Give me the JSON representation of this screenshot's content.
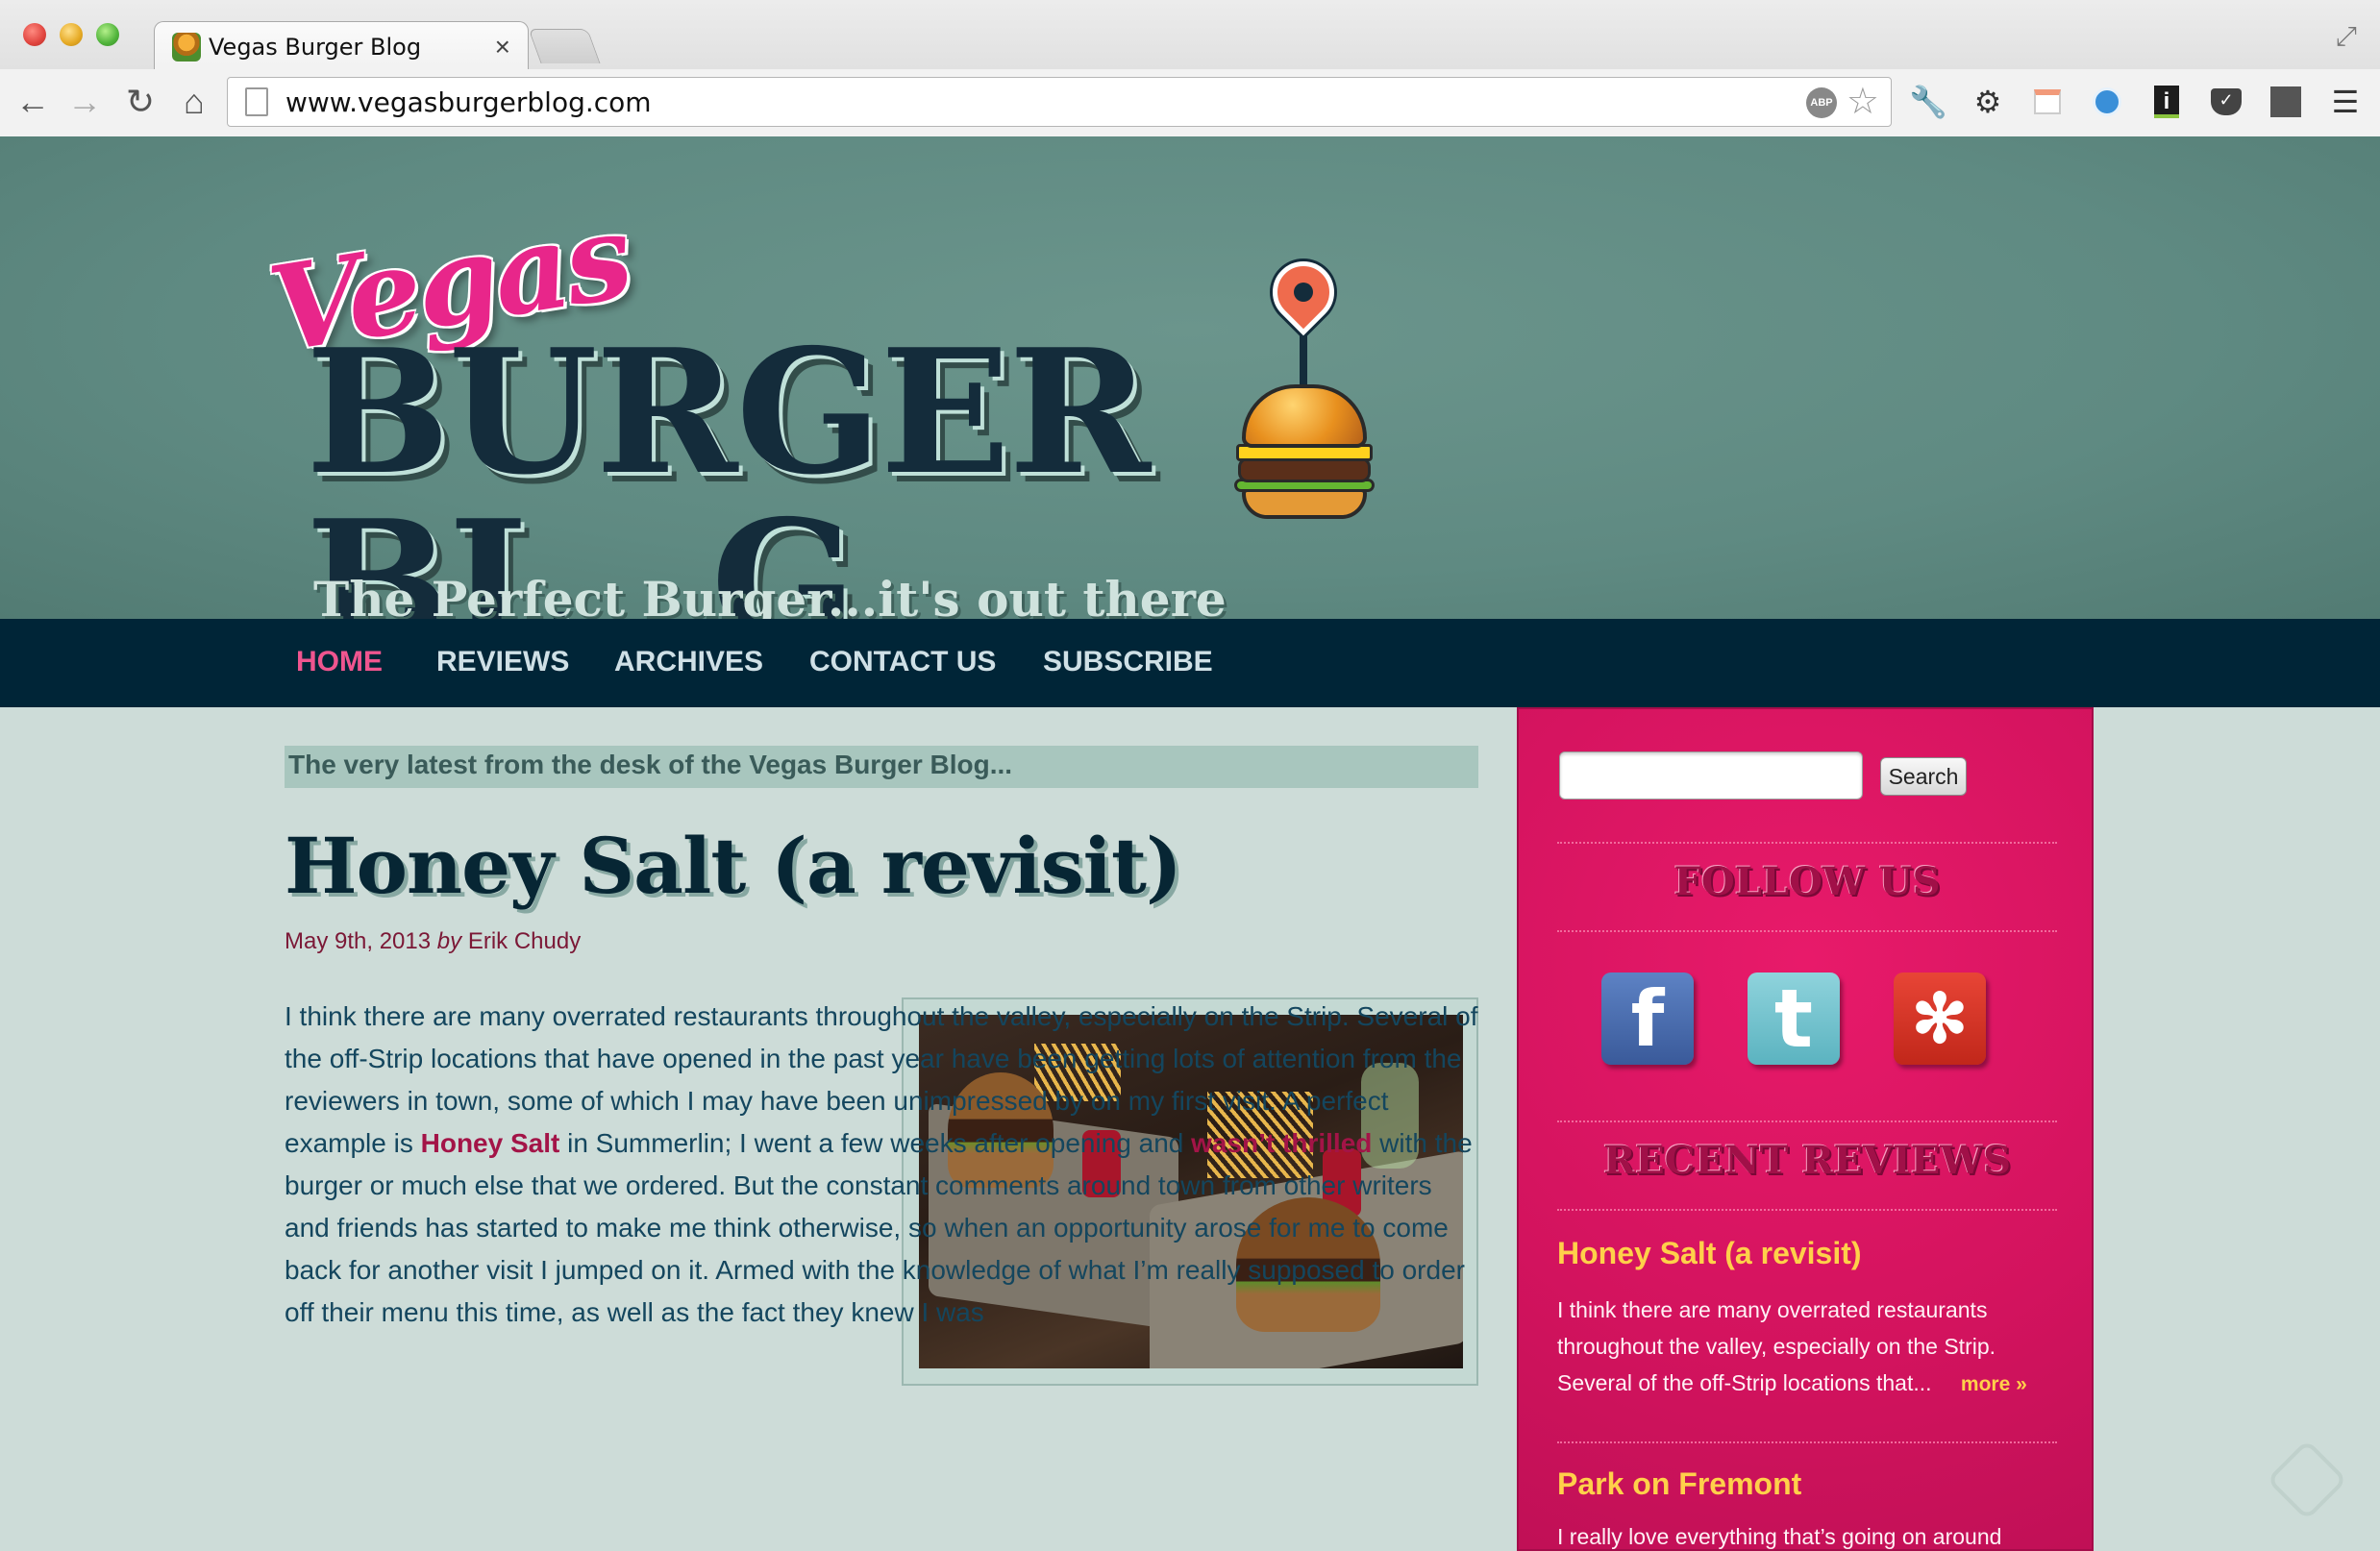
{
  "browser": {
    "tab_title": "Vegas Burger Blog",
    "tab_close": "×",
    "url": "www.vegasburgerblog.com",
    "back": "←",
    "forward": "→",
    "reload": "↻",
    "home": "⌂",
    "abp_label": "ABP",
    "star": "☆",
    "extensions": [
      "wrench-icon",
      "gear-icon",
      "calendar-icon",
      "phone-icon",
      "info-icon",
      "pocket-icon",
      "evernote-icon",
      "menu-icon"
    ]
  },
  "header": {
    "logo_vegas": "Vegas",
    "logo_main": "BURGER BL",
    "logo_g": "G",
    "tagline": "The Perfect Burger...it's out there"
  },
  "nav": {
    "items": [
      {
        "label": "HOME",
        "active": true
      },
      {
        "label": "REVIEWS",
        "active": false
      },
      {
        "label": "ARCHIVES",
        "active": false
      },
      {
        "label": "CONTACT US",
        "active": false
      },
      {
        "label": "SUBSCRIBE",
        "active": false
      }
    ]
  },
  "main": {
    "latest_text": "The very latest from the desk of the Vegas Burger Blog...",
    "post": {
      "title": "Honey Salt (a revisit)",
      "date": "May 9th, 2013",
      "by": "by",
      "author": "Erik Chudy",
      "body_intro": "I think there are many overrated restaurants throughout the valley, especially on the Strip. Several of the off-Strip locations that have opened in the past year have been getting lots of attention from the reviewers in town, some of which I may have been unimpressed by on my first visit. A perfect example is",
      "link1": "Honey Salt",
      "body_mid1": "in Summerlin; I went a few weeks after opening and",
      "link2": "wasn’t thrilled",
      "body_mid2": "with the burger or much else that we ordered. But the constant comments around town from other writers and friends has started to make me think otherwise, so when an opportunity arose for me to come back for another visit I jumped on it. Armed with the knowledge of what I’m really supposed to order off their menu this time, as well as the fact they knew I was"
    }
  },
  "sidebar": {
    "search_placeholder": "",
    "search_button": "Search",
    "follow_title": "FOLLOW US",
    "social": [
      {
        "name": "facebook-icon",
        "glyph": "f"
      },
      {
        "name": "twitter-icon",
        "glyph": "t"
      },
      {
        "name": "yelp-icon",
        "glyph": "✻"
      }
    ],
    "recent_title": "RECENT REVIEWS",
    "reviews": [
      {
        "title": "Honey Salt (a revisit)",
        "excerpt": "I think there are many overrated restaurants throughout the valley, especially on the Strip. Several of the off-Strip locations that...",
        "more": "more »"
      },
      {
        "title": "Park on Fremont",
        "excerpt": "I really love everything that’s going on around",
        "more": ""
      }
    ]
  },
  "colors": {
    "header_bg": "#5f8a82",
    "nav_bg": "#002537",
    "nav_active": "#f0558f",
    "sidebar_bg": "#d3135e",
    "review_title": "#ffd04a",
    "link": "#a31447"
  }
}
